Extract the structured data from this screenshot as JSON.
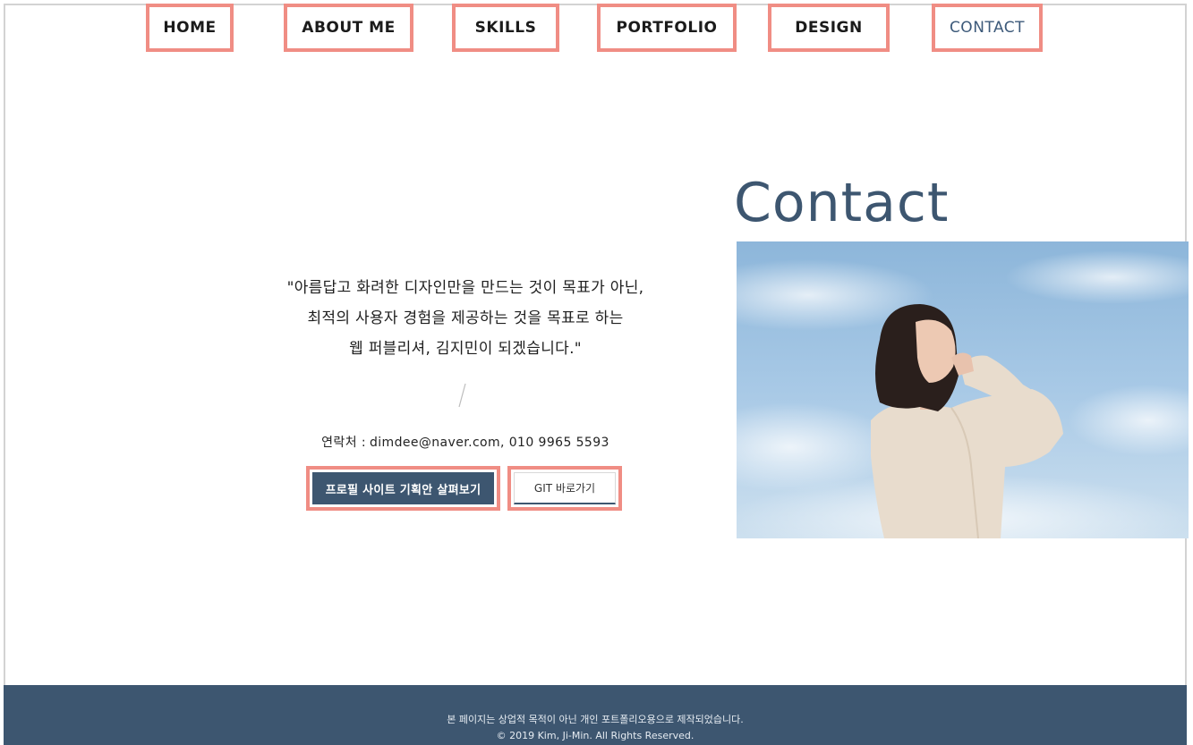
{
  "nav": {
    "items": [
      {
        "label": "HOME"
      },
      {
        "label": "ABOUT ME"
      },
      {
        "label": "SKILLS"
      },
      {
        "label": "PORTFOLIO"
      },
      {
        "label": "DESIGN"
      },
      {
        "label": "CONTACT"
      }
    ],
    "active": "CONTACT"
  },
  "contact": {
    "title": "Contact",
    "quote_lines": [
      "\"아름답고 화려한 디자인만을 만드는 것이 목표가 아닌,",
      "최적의 사용자 경험을 제공하는 것을 목표로 하는",
      "웹 퍼블리셔, 김지민이 되겠습니다.\""
    ],
    "contact_label": "연락처 :",
    "contact_value": "dimdee@naver.com, 010 9965 5593",
    "primary_button": "프로필 사이트 기획안 살펴보기",
    "secondary_button": "GIT 바로가기"
  },
  "footer": {
    "line1": "본 페이지는 상업적 목적이 아닌 개인 포트폴리오용으로 제작되었습니다.",
    "line2": "© 2019 Kim, Ji-Min. All Rights Reserved."
  },
  "colors": {
    "accent": "#3d5670",
    "highlight_border": "#f08d84",
    "sky": "#a9cae6"
  },
  "icons": {
    "divider": "slash-divider-icon"
  }
}
